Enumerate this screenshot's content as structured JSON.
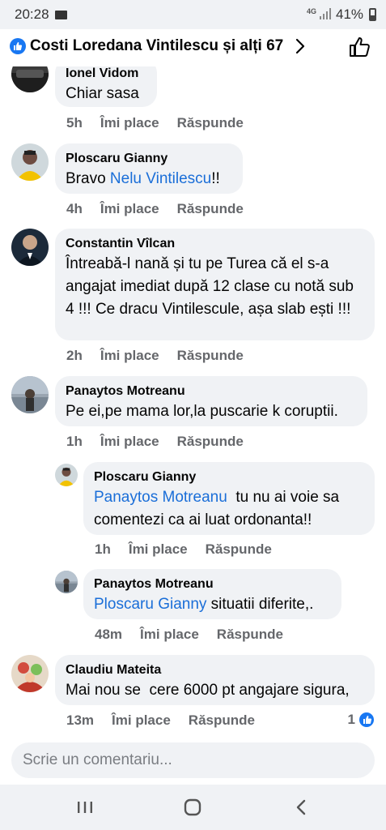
{
  "status_bar": {
    "time": "20:28",
    "network": "4G",
    "battery": "41%",
    "icons": [
      "mail-icon",
      "signal-icon",
      "battery-icon"
    ]
  },
  "header": {
    "title": "Costi Loredana Vintilescu și alți 67",
    "icons": [
      "like-badge-icon",
      "chevron-right-icon",
      "thumbs-up-icon"
    ]
  },
  "comments": [
    {
      "name": "Ionel Vidom",
      "text": "Chiar sasa",
      "time": "5h",
      "like_label": "Îmi place",
      "reply_label": "Răspunde"
    },
    {
      "name": "Ploscaru Gianny",
      "text_before": "Bravo ",
      "mention": "Nelu Vintilescu",
      "text_after": "!!",
      "time": "4h",
      "like_label": "Îmi place",
      "reply_label": "Răspunde"
    },
    {
      "name": "Constantin Vîlcan",
      "text": "Întreabă-l nană și tu pe Turea că el s-a angajat imediat după 12 clase cu notă sub 4 !!! Ce dracu Vintilescule, așa slab ești !!!",
      "time": "2h",
      "like_label": "Îmi place",
      "reply_label": "Răspunde"
    },
    {
      "name": "Panaytos Motreanu",
      "text": "Pe ei,pe mama lor,la puscarie k coruptii.",
      "time": "1h",
      "like_label": "Îmi place",
      "reply_label": "Răspunde"
    },
    {
      "name": "Ploscaru Gianny",
      "mention": "Panaytos Motreanu",
      "text_after": "  tu nu ai voie sa comentezi ca ai luat ordonanta!!",
      "time": "1h",
      "like_label": "Îmi place",
      "reply_label": "Răspunde"
    },
    {
      "name": "Panaytos Motreanu",
      "mention": "Ploscaru Gianny",
      "text_after": " situatii diferite,.",
      "time": "48m",
      "like_label": "Îmi place",
      "reply_label": "Răspunde"
    },
    {
      "name": "Claudiu Mateita",
      "text": "Mai nou se  cere 6000 pt angajare sigura,",
      "time": "13m",
      "like_label": "Îmi place",
      "reply_label": "Răspunde",
      "reaction_count": "1"
    }
  ],
  "composer": {
    "placeholder": "Scrie un comentariu..."
  },
  "navbar": {
    "icons": [
      "recent-apps-icon",
      "home-icon",
      "back-icon"
    ]
  },
  "colors": {
    "accent": "#1877f2",
    "mention": "#1a6ed8",
    "bubble": "#f0f2f5",
    "meta_text": "#65676b"
  }
}
